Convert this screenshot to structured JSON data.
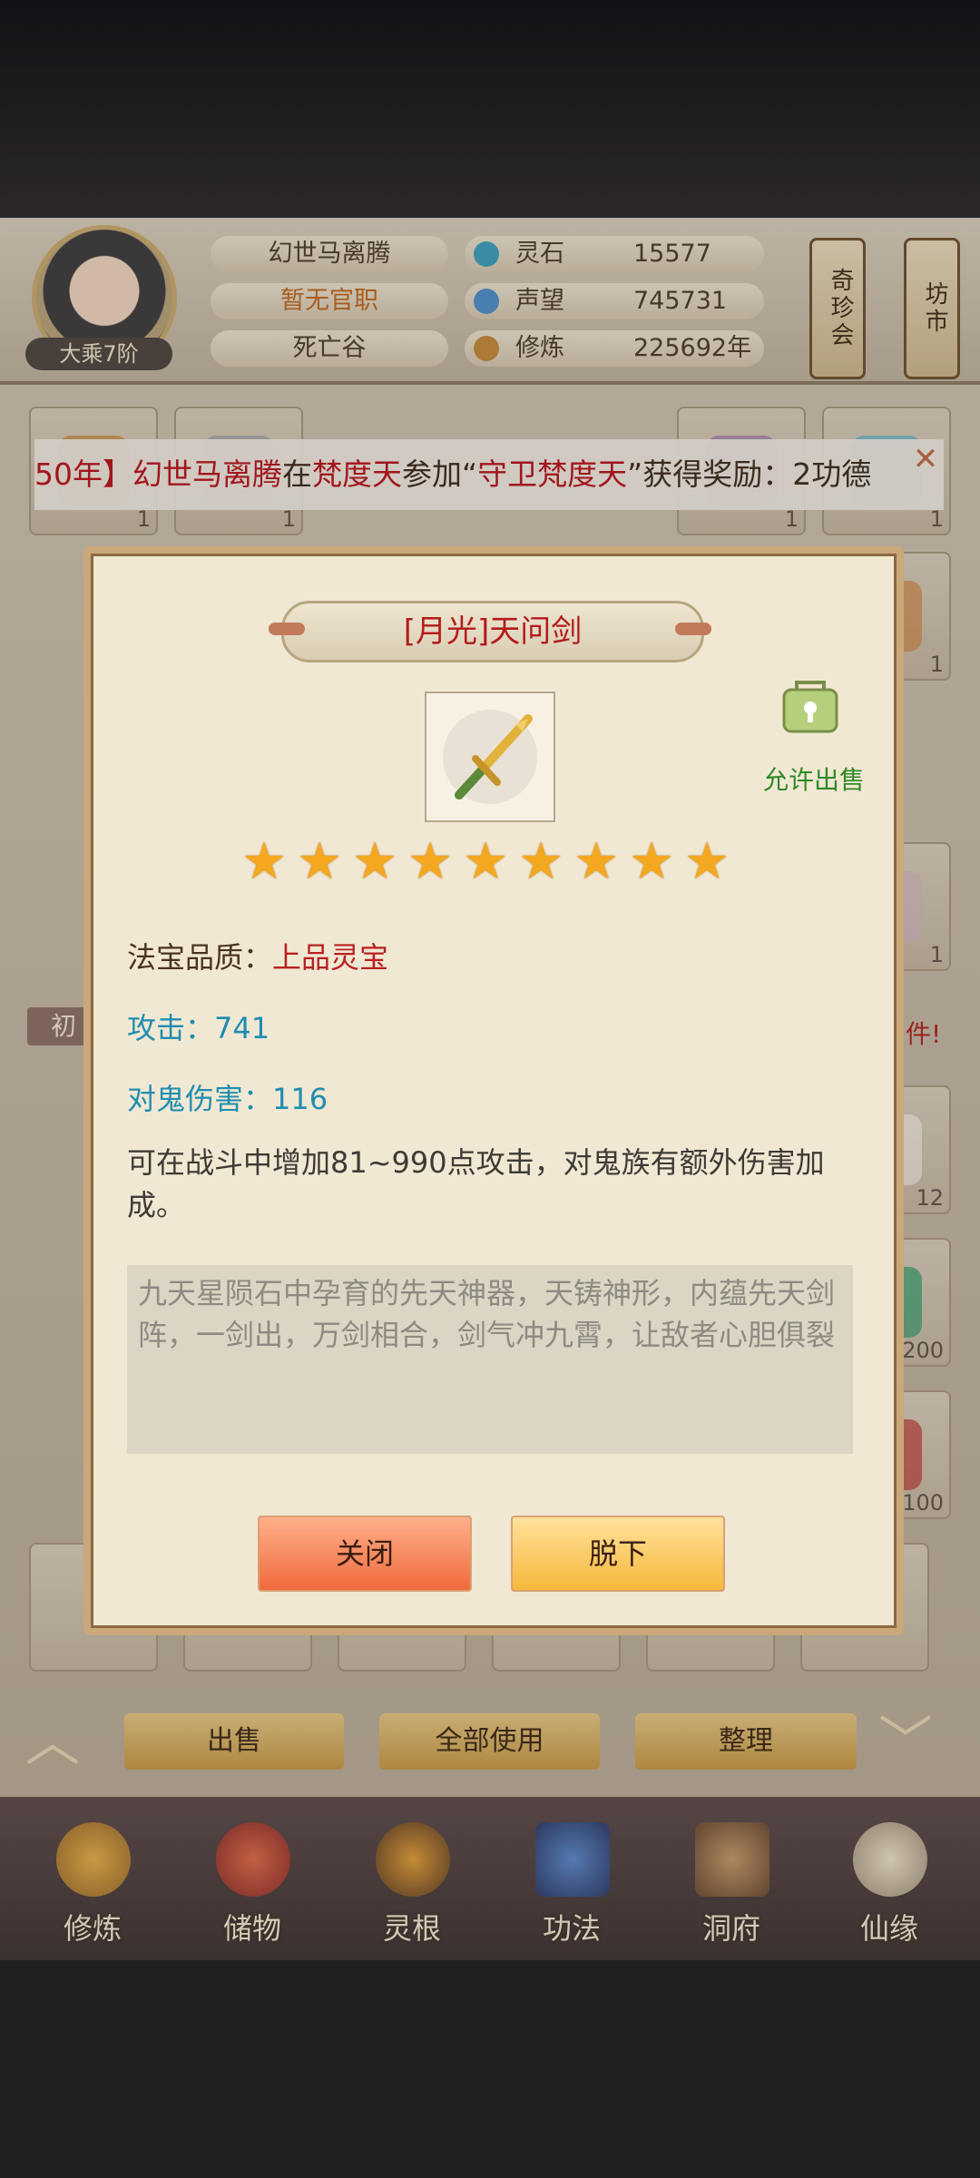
{
  "player": {
    "name": "幻世马离腾",
    "official_rank": "暂无官职",
    "location": "死亡谷",
    "cultivation_stage": "大乘7阶"
  },
  "resources": [
    {
      "label": "灵石",
      "value": "15577",
      "icon": "spirit-stone-icon",
      "color": "#3aa0c0"
    },
    {
      "label": "声望",
      "value": "745731",
      "icon": "prestige-icon",
      "color": "#4c8fd0"
    },
    {
      "label": "修炼",
      "value": "225692年",
      "icon": "meditation-icon",
      "color": "#c58a3a"
    }
  ],
  "side_buttons": [
    {
      "label": "奇珍会"
    },
    {
      "label": "坊市"
    }
  ],
  "marquee": {
    "part1": "50年】",
    "player": "幻世马离腾",
    "mid1": "在",
    "place": "梵度天",
    "mid2": "参加“",
    "event": "守卫梵度天",
    "mid3": "”获得奖励：2功德"
  },
  "inventory": {
    "counts": [
      "1",
      "1",
      "1",
      "1",
      "1",
      "1",
      "12",
      "200",
      "100"
    ],
    "partial_tab_label": "初",
    "partial_notice": "多件!"
  },
  "actions": {
    "sell": "出售",
    "use_all": "全部使用",
    "organize": "整理"
  },
  "nav": [
    {
      "label": "修炼",
      "icon": "meditate-figure-icon"
    },
    {
      "label": "储物",
      "icon": "treasure-bag-icon"
    },
    {
      "label": "灵根",
      "icon": "spirit-root-icon"
    },
    {
      "label": "功法",
      "icon": "book-icon"
    },
    {
      "label": "洞府",
      "icon": "cave-house-icon"
    },
    {
      "label": "仙缘",
      "icon": "gourd-icon"
    }
  ],
  "dialog": {
    "title": "[月光]天问剑",
    "item_icon": "sword-icon",
    "sell_status": "允许出售",
    "star_count": 9,
    "quality_label": "法宝品质：",
    "quality_value": "上品灵宝",
    "attack": "攻击：741",
    "ghost_damage": "对鬼伤害：116",
    "description": "可在战斗中增加81~990点攻击，对鬼族有额外伤害加成。",
    "lore": "九天星陨石中孕育的先天神器，天铸神形，内蕴先天剑阵，一剑出，万剑相合，剑气冲九霄，让敌者心胆俱裂",
    "close_label": "关闭",
    "unequip_label": "脱下"
  },
  "colors": {
    "title_red": "#b31b1b",
    "stat_blue": "#1f8db0",
    "sell_green": "#2f8a25",
    "star_gold": "#f3a81f"
  }
}
